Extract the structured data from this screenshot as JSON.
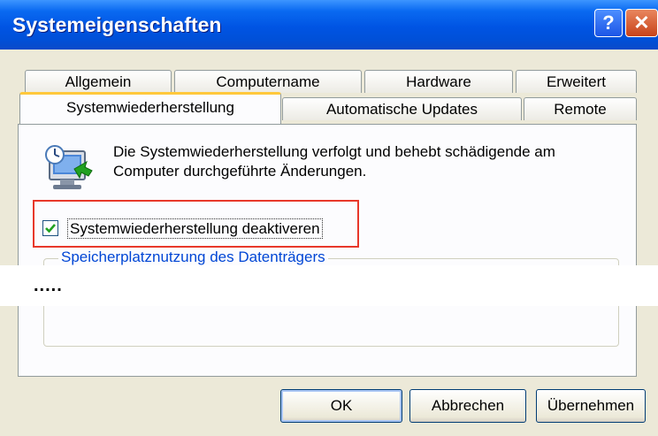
{
  "window": {
    "title": "Systemeigenschaften",
    "help_glyph": "?",
    "close_glyph": "✕"
  },
  "tabs_row1": [
    "Allgemein",
    "Computername",
    "Hardware",
    "Erweitert"
  ],
  "tabs_row2": [
    "Systemwiederherstellung",
    "Automatische Updates",
    "Remote"
  ],
  "active_tab": "Systemwiederherstellung",
  "panel": {
    "icon": "system-restore-icon",
    "description_line1": "Die Systemwiederherstellung verfolgt und behebt schädigende am",
    "description_line2": "Computer durchgeführte Änderungen.",
    "checkbox_label": "Systemwiederherstellung deaktiveren",
    "checkbox_checked": true,
    "group_label": "Speicherplatznutzung des Datenträgers",
    "masked_text": "....."
  },
  "buttons": {
    "ok": "OK",
    "cancel": "Abbrechen",
    "apply": "Übernehmen"
  },
  "colors": {
    "titlebar": "#0054e3",
    "dialog_bg": "#ece9d8",
    "active_tab_accent": "#ffc83c",
    "group_label": "#0046d5",
    "highlight_box": "#e8382a",
    "checkmark": "#21a121"
  }
}
